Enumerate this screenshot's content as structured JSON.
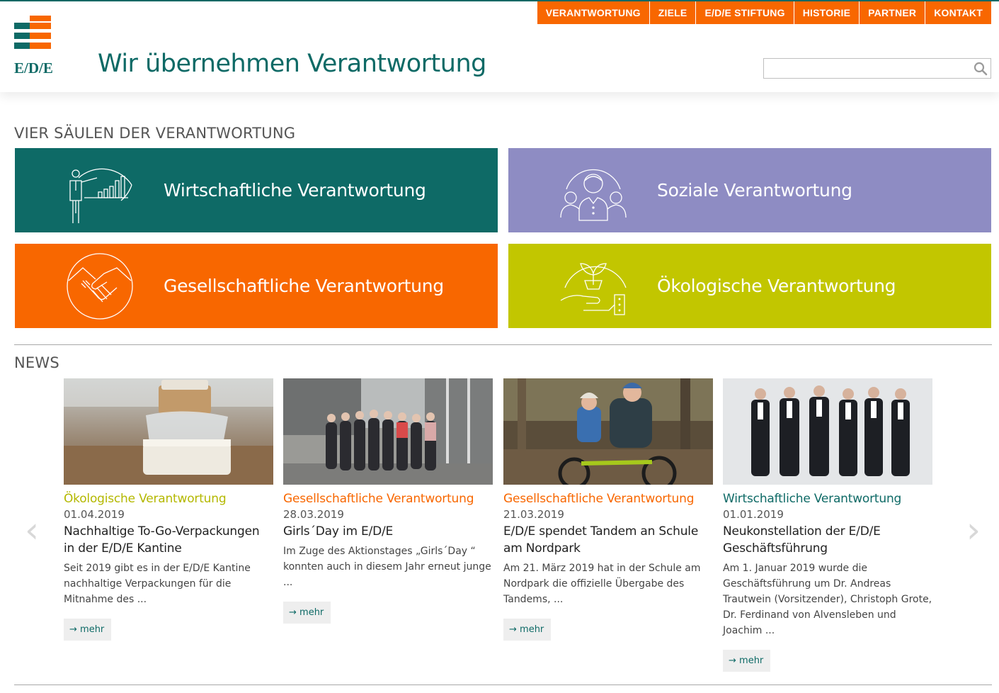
{
  "brand": {
    "logo_text": "E/D/E",
    "title": "Wir übernehmen Verantwortung",
    "accent": "#0e6a66",
    "nav_bg": "#f86700"
  },
  "nav": [
    "VERANTWORTUNG",
    "ZIELE",
    "E/D/E STIFTUNG",
    "HISTORIE",
    "PARTNER",
    "KONTAKT"
  ],
  "search": {
    "placeholder": "",
    "value": "",
    "icon": "search-icon"
  },
  "pillars": {
    "heading": "VIER SÄULEN DER VERANTWORTUNG",
    "tiles": [
      {
        "label": "Wirtschaftliche Verantwortung",
        "color": "#0e6a66",
        "icon": "presentation-chart-icon"
      },
      {
        "label": "Soziale Verantwortung",
        "color": "#8e8cc3",
        "icon": "people-group-icon"
      },
      {
        "label": "Gesellschaftliche Verantwortung",
        "color": "#f86700",
        "icon": "handshake-icon"
      },
      {
        "label": "Ökologische Verantwortung",
        "color": "#c2c600",
        "icon": "plant-hand-icon"
      }
    ]
  },
  "news": {
    "heading": "NEWS",
    "prev_arrow": "‹",
    "next_arrow": "›",
    "items": [
      {
        "category": "Ökologische Verantwortung",
        "category_color": "#b4b800",
        "date": "01.04.2019",
        "title": "Nachhaltige To-Go-Verpackungen in der E/D/E Kantine",
        "text": "Seit 2019 gibt es in der E/D/E Kantine nachhaltige Verpackungen für die Mitnahme des ...",
        "more": "mehr"
      },
      {
        "category": "Gesellschaftliche Verantwortung",
        "category_color": "#f86700",
        "date": "28.03.2019",
        "title": "Girls´Day im E/D/E",
        "text": "Im Zuge des Aktionstages „Girls´Day “ konnten auch in diesem Jahr erneut junge ...",
        "more": "mehr"
      },
      {
        "category": "Gesellschaftliche Verantwortung",
        "category_color": "#f86700",
        "date": "21.03.2019",
        "title": "E/D/E spendet Tandem an Schule am Nordpark",
        "text": "Am 21. März 2019 hat in der Schule am Nordpark  die offizielle Übergabe des Tandems, ...",
        "more": "mehr"
      },
      {
        "category": "Wirtschaftliche Verantwortung",
        "category_color": "#0e6a66",
        "date": "01.01.2019",
        "title": "Neukonstellation der E/D/E Geschäftsführung",
        "text": "Am 1. Januar 2019 wurde die Geschäftsführung um Dr. Andreas Trautwein (Vorsitzender), Christoph Grote, Dr. Ferdinand von Alvensleben und Joachim ...",
        "more": "mehr"
      }
    ]
  }
}
